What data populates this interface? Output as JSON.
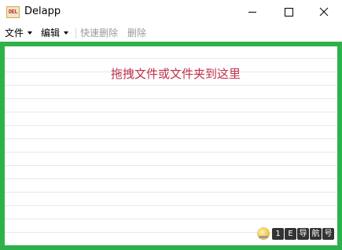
{
  "window": {
    "icon_text": "DEL",
    "title": "Delapp"
  },
  "menu": {
    "file": "文件",
    "edit": "编辑",
    "quick_delete": "快速删除",
    "delete": "删除"
  },
  "dropzone": {
    "hint": "拖拽文件或文件夹到这里",
    "border_color": "#2db24a",
    "hint_color": "#c0304a"
  },
  "watermark": {
    "chars": [
      "1",
      "E",
      "导",
      "航",
      "号"
    ]
  },
  "icons": {
    "minimize": "minimize-icon",
    "maximize": "maximize-icon",
    "close": "close-icon"
  }
}
